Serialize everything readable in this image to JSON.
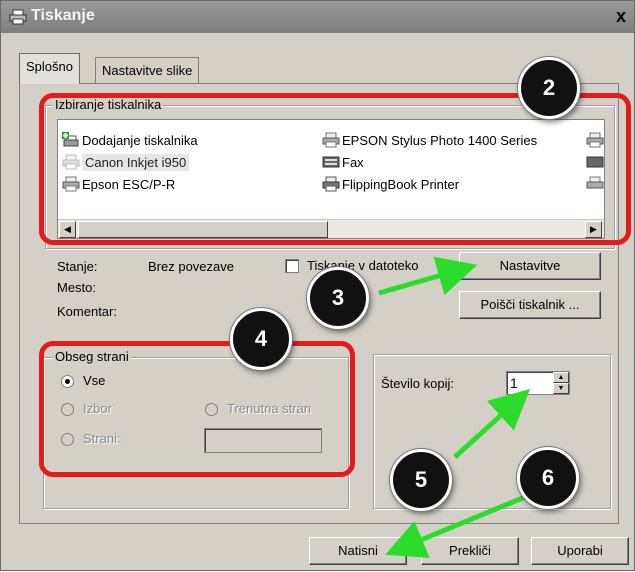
{
  "window": {
    "title": "Tiskanje",
    "close_label": "x"
  },
  "tabs": [
    {
      "label": "Splošno",
      "active": true
    },
    {
      "label": "Nastavitve slike",
      "active": false
    }
  ],
  "printer_group": {
    "label": "Izbiranje tiskalnika",
    "items": [
      {
        "label": "Dodajanje tiskalnika",
        "icon": "add-printer-icon",
        "selected": false
      },
      {
        "label": "EPSON Stylus Photo 1400 Series",
        "icon": "printer-icon",
        "selected": false
      },
      {
        "label": "Canon Inkjet i950",
        "icon": "printer-icon",
        "selected": true
      },
      {
        "label": "Fax",
        "icon": "fax-icon",
        "selected": false
      },
      {
        "label": "Epson ESC/P-R",
        "icon": "printer-icon",
        "selected": false
      },
      {
        "label": "FlippingBook Printer",
        "icon": "printer-icon",
        "selected": false
      }
    ]
  },
  "status": {
    "stanje_label": "Stanje:",
    "stanje_value": "Brez povezave",
    "mesto_label": "Mesto:",
    "komentar_label": "Komentar:"
  },
  "print_to_file": {
    "label": "Tiskanje v datoteko",
    "checked": false
  },
  "buttons": {
    "nastavitve": "Nastavitve",
    "poisci": "Poišči tiskalnik ...",
    "natisni": "Natisni",
    "preklici": "Prekliči",
    "uporabi": "Uporabi"
  },
  "page_range": {
    "label": "Obseg strani",
    "vse": "Vse",
    "izbor": "Izbor",
    "trenutna": "Trenutna stran",
    "strani": "Strani:",
    "selected": "Vse"
  },
  "copies": {
    "label": "Število kopij:",
    "value": "1"
  },
  "callouts": [
    "2",
    "3",
    "4",
    "5",
    "6"
  ],
  "colors": {
    "highlight": "#e21b1b",
    "arrow": "#2bdc2b",
    "badge": "#111111"
  }
}
